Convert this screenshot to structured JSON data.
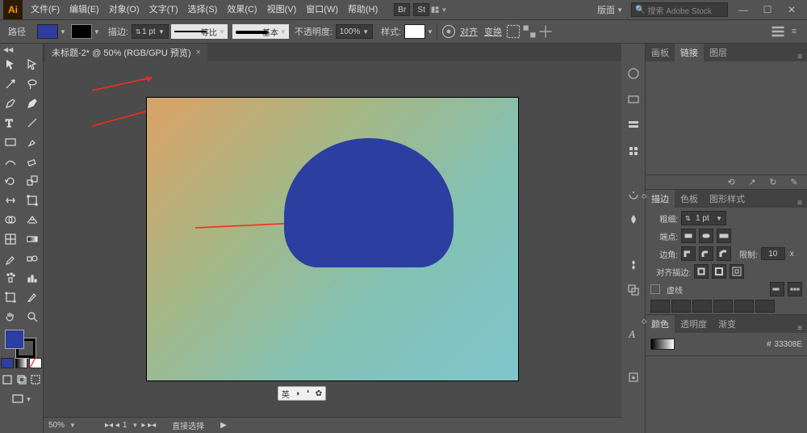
{
  "menubar": {
    "menus": [
      "文件(F)",
      "编辑(E)",
      "对象(O)",
      "文字(T)",
      "选择(S)",
      "效果(C)",
      "视图(V)",
      "窗口(W)",
      "帮助(H)"
    ],
    "bridge_label": "Br",
    "stock_label": "St",
    "layout_label": "版面",
    "search_placeholder": "搜索 Adobe Stock"
  },
  "ctrlbar": {
    "label_left": "路径",
    "stroke_label": "描边:",
    "stroke_value": "1 pt",
    "profile1": "等比",
    "profile2": "基本",
    "opacity_label": "不透明度:",
    "opacity_value": "100%",
    "style_label": "样式:",
    "align_label": "对齐",
    "transform_label": "变换"
  },
  "document": {
    "title": "未标题-2* @ 50% (RGB/GPU 预览)",
    "zoom": "50%",
    "page_info": "1",
    "status_tool": "直接选择"
  },
  "ime": {
    "lang": "英"
  },
  "right": {
    "panel1_tabs": [
      "画板",
      "链接",
      "图层"
    ],
    "stroke_panel": {
      "tabs": [
        "描边",
        "色板",
        "图形样式"
      ],
      "weight_label": "粗细:",
      "weight_value": "1 pt",
      "cap_label": "端点:",
      "join_label": "边角:",
      "limit_label": "限制:",
      "limit_value": "10",
      "limit_unit": "x",
      "align_label": "对齐描边:",
      "dash_label": "虚线"
    },
    "color_panel": {
      "tabs": [
        "颜色",
        "透明度",
        "渐变"
      ],
      "hex": "33308E"
    }
  }
}
